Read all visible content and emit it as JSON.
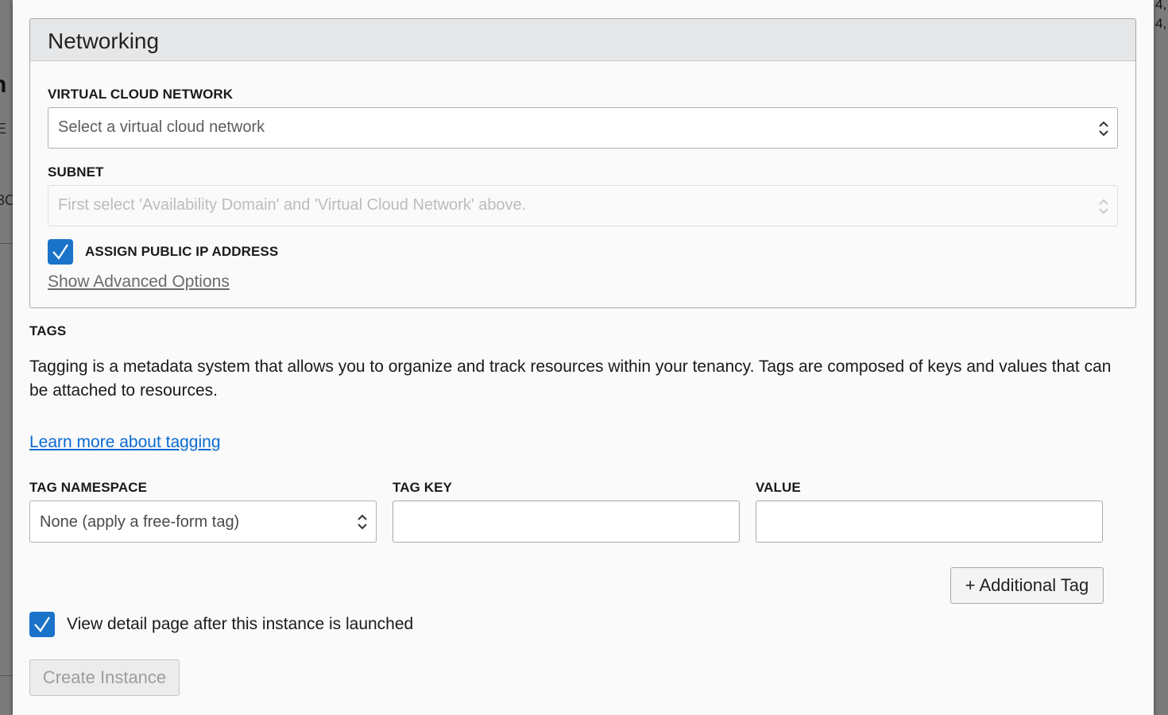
{
  "background": {
    "left_fragments": [
      "n",
      "E",
      "3C"
    ],
    "right_fragments": [
      "4,",
      "4,"
    ]
  },
  "networking": {
    "title": "Networking",
    "vcn_label": "VIRTUAL CLOUD NETWORK",
    "vcn_placeholder": "Select a virtual cloud network",
    "subnet_label": "SUBNET",
    "subnet_placeholder": "First select 'Availability Domain' and 'Virtual Cloud Network' above.",
    "assign_public_ip_label": "ASSIGN PUBLIC IP ADDRESS",
    "assign_public_ip_checked": true,
    "show_advanced_link": "Show Advanced Options"
  },
  "tags": {
    "heading": "TAGS",
    "description": "Tagging is a metadata system that allows you to organize and track resources within your tenancy. Tags are composed of keys and values that can be attached to resources.",
    "learn_more_link": "Learn more about tagging",
    "namespace_label": "TAG NAMESPACE",
    "namespace_value": "None (apply a free-form tag)",
    "key_label": "TAG KEY",
    "key_value": "",
    "value_label": "VALUE",
    "value_value": "",
    "additional_tag_button": "+ Additional Tag"
  },
  "footer": {
    "view_detail_label": "View detail page after this instance is launched",
    "view_detail_checked": true,
    "create_button": "Create Instance"
  },
  "colors": {
    "accent": "#1a73c9",
    "link": "#0a6ad0"
  }
}
